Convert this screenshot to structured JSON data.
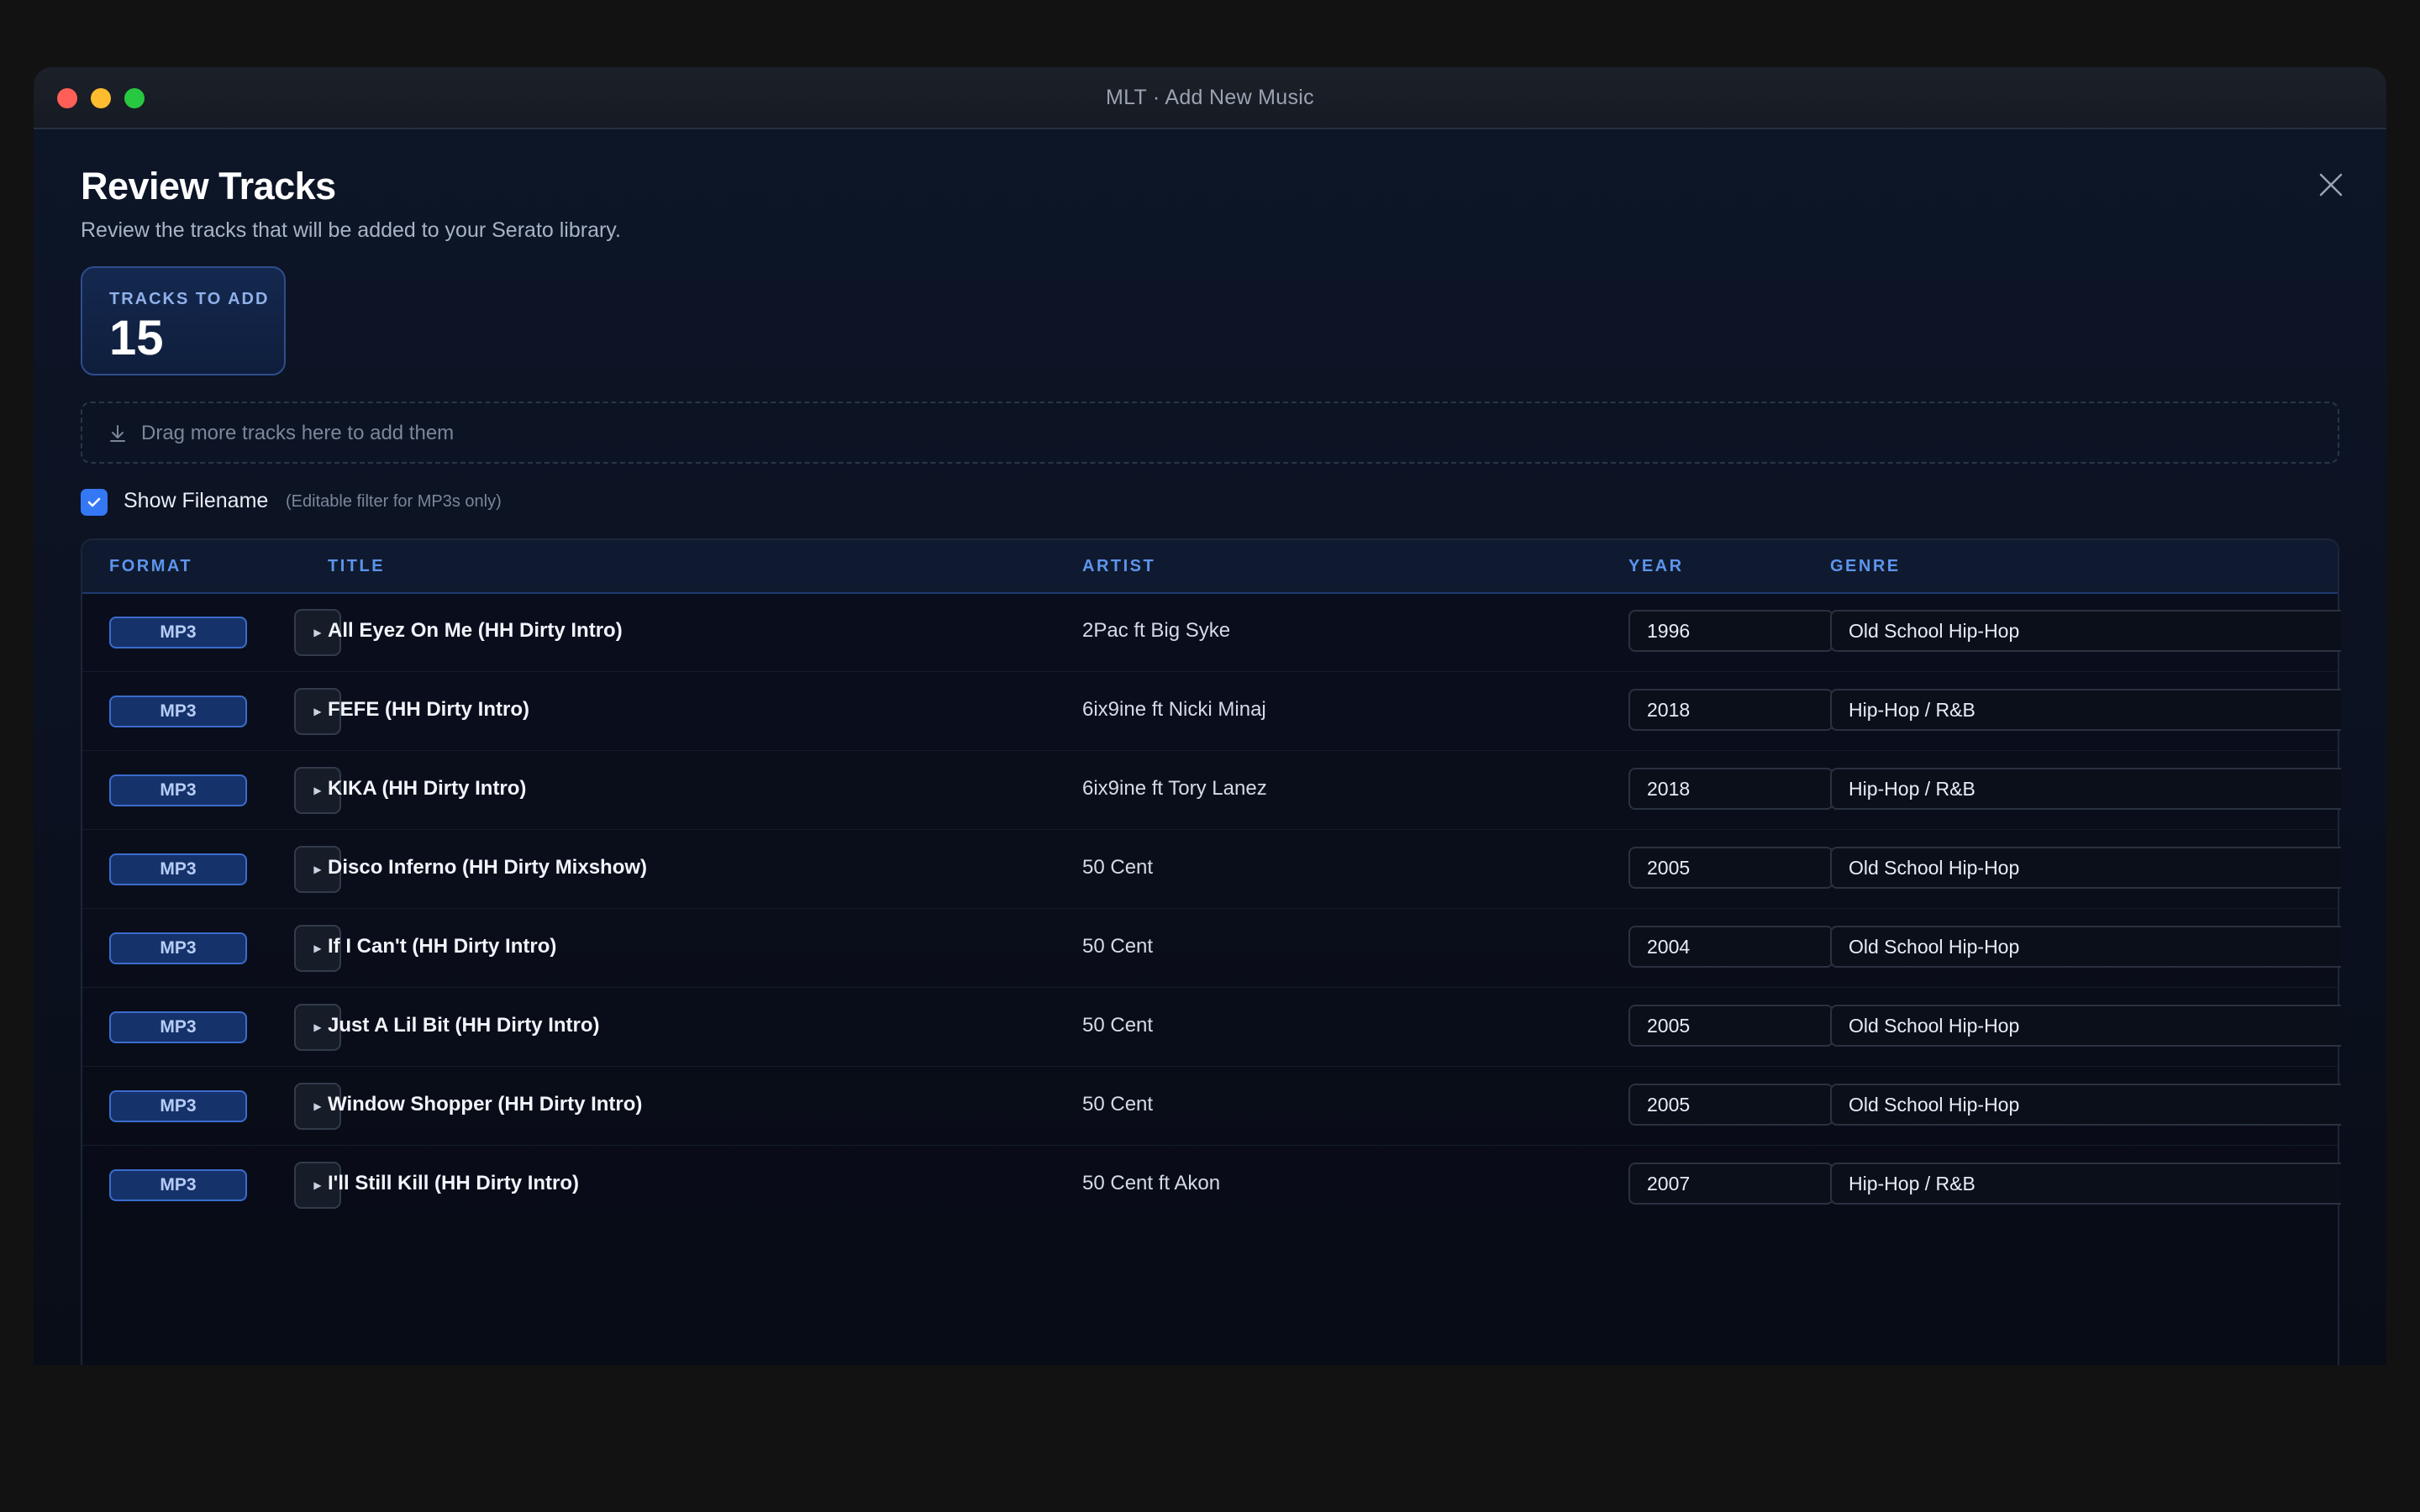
{
  "window": {
    "title": "MLT · Add New Music"
  },
  "header": {
    "heading": "Review Tracks",
    "subtitle": "Review the tracks that will be added to your Serato library."
  },
  "stats": {
    "label": "TRACKS TO ADD",
    "value": "15"
  },
  "dropzone": {
    "icon": "download-icon",
    "text": "Drag more tracks here to add them"
  },
  "filter": {
    "checked": true,
    "label": "Show Filename",
    "hint": "(Editable filter for MP3s only)"
  },
  "table": {
    "columns": {
      "format": "FORMAT",
      "title": "TITLE",
      "artist": "ARTIST",
      "year": "YEAR",
      "genre": "GENRE"
    },
    "rows": [
      {
        "format": "MP3",
        "title": "All Eyez On Me (HH Dirty Intro)",
        "artist": "2Pac ft Big Syke",
        "year": "1996",
        "genre": "Old School Hip-Hop"
      },
      {
        "format": "MP3",
        "title": "FEFE (HH Dirty Intro)",
        "artist": "6ix9ine ft Nicki Minaj",
        "year": "2018",
        "genre": "Hip-Hop / R&B"
      },
      {
        "format": "MP3",
        "title": "KIKA (HH Dirty Intro)",
        "artist": "6ix9ine ft Tory Lanez",
        "year": "2018",
        "genre": "Hip-Hop / R&B"
      },
      {
        "format": "MP3",
        "title": "Disco Inferno (HH Dirty Mixshow)",
        "artist": "50 Cent",
        "year": "2005",
        "genre": "Old School Hip-Hop"
      },
      {
        "format": "MP3",
        "title": "If I Can't (HH Dirty Intro)",
        "artist": "50 Cent",
        "year": "2004",
        "genre": "Old School Hip-Hop"
      },
      {
        "format": "MP3",
        "title": "Just A Lil Bit (HH Dirty Intro)",
        "artist": "50 Cent",
        "year": "2005",
        "genre": "Old School Hip-Hop"
      },
      {
        "format": "MP3",
        "title": "Window Shopper (HH Dirty Intro)",
        "artist": "50 Cent",
        "year": "2005",
        "genre": "Old School Hip-Hop"
      },
      {
        "format": "MP3",
        "title": "I'll Still Kill (HH Dirty Intro)",
        "artist": "50 Cent ft Akon",
        "year": "2007",
        "genre": "Hip-Hop / R&B"
      }
    ],
    "play_icon": "play-icon",
    "play_glyph": "▶"
  },
  "colors": {
    "accent": "#3478f6",
    "header_text": "#5d95ec",
    "badge_border": "#3a6ccc"
  }
}
